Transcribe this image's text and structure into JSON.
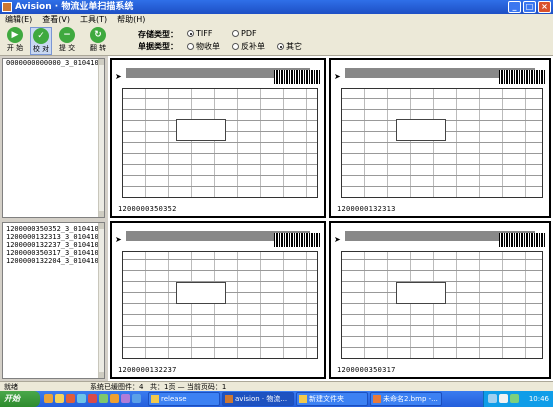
{
  "window": {
    "title": "Avision · 物流业单扫描系统"
  },
  "menu": [
    "编辑(E)",
    "查看(V)",
    "工具(T)",
    "帮助(H)"
  ],
  "toolbar": {
    "buttons": [
      {
        "label": "开 始",
        "icon": "play-icon",
        "color": "#3fa93f"
      },
      {
        "label": "校 对",
        "icon": "check-icon",
        "color": "#3fa93f"
      },
      {
        "label": "提 交",
        "icon": "minus-icon",
        "color": "#3fa93f"
      },
      {
        "label": "翻 转",
        "icon": "rotate-icon",
        "color": "#3fa93f"
      }
    ],
    "storage_label": "存储类型：",
    "storage_options": [
      "TIFF",
      "PDF"
    ],
    "storage_selected": "TIFF",
    "doctype_label": "单据类型：",
    "doctype_options": [
      "物收单",
      "反补单",
      "其它"
    ],
    "doctype_selected": "其它"
  },
  "top_list": [
    "0000000000000_3_0104103"
  ],
  "bottom_list": [
    "1200000350352_3_0104103",
    "1200000132313_3_0104103",
    "1200000132237_3_0104103",
    "1200000350317_3_0104103",
    "1200000132204_3_0104103"
  ],
  "documents": [
    {
      "number": "1200000350352"
    },
    {
      "number": "1200000132313"
    },
    {
      "number": "1200000132237"
    },
    {
      "number": "1200000350317"
    }
  ],
  "statusbar": {
    "state": "就绪",
    "system": "系统已缓图件：4",
    "pages": "共：1页 — 当前页码：1"
  },
  "taskbar": {
    "start": "开始",
    "tasks": [
      "release",
      "avision · 物流...",
      "新建文件夹",
      "未命名2.bmp -..."
    ],
    "clock": "10:46"
  }
}
